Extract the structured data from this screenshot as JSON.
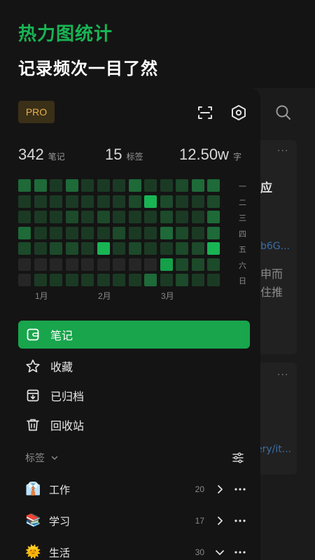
{
  "header": {
    "title": "热力图统计",
    "subtitle": "记录频次一目了然"
  },
  "background": {
    "title_fragment": "应",
    "link1": "b6G...",
    "text1": "申而",
    "text2": "住推",
    "link2": "ery/it...",
    "more": "···"
  },
  "drawer": {
    "pro_label": "PRO",
    "icons": {
      "scan": "scan-icon",
      "settings": "hexagon-settings-icon",
      "search": "search-icon"
    },
    "stats": [
      {
        "value": "342",
        "label": "笔记"
      },
      {
        "value": "15",
        "label": "标签"
      },
      {
        "value": "12.50w",
        "label": "字"
      }
    ],
    "heatmap": {
      "weekdays": [
        "一",
        "二",
        "三",
        "四",
        "五",
        "六",
        "日"
      ],
      "months": [
        "1月",
        "2月",
        "3月"
      ],
      "levels": [
        [
          3,
          3,
          1,
          3,
          1,
          1,
          1,
          3,
          1,
          1,
          2,
          3,
          3
        ],
        [
          1,
          1,
          1,
          1,
          1,
          1,
          1,
          2,
          5,
          2,
          1,
          1,
          2
        ],
        [
          1,
          1,
          1,
          2,
          1,
          2,
          1,
          1,
          1,
          2,
          1,
          1,
          3
        ],
        [
          3,
          1,
          1,
          1,
          1,
          1,
          2,
          1,
          1,
          3,
          2,
          1,
          3
        ],
        [
          2,
          1,
          2,
          2,
          1,
          5,
          1,
          2,
          1,
          1,
          2,
          2,
          5
        ],
        [
          0,
          0,
          0,
          0,
          0,
          0,
          0,
          0,
          0,
          4,
          2,
          2,
          2
        ],
        [
          0,
          1,
          1,
          1,
          1,
          1,
          1,
          1,
          3,
          1,
          2,
          1,
          1
        ]
      ],
      "colors": [
        "#262626",
        "#1b3a24",
        "#1c4a2a",
        "#1e6a38",
        "#15a04a",
        "#19b454"
      ]
    },
    "nav": [
      {
        "label": "笔记",
        "icon": "note-icon",
        "active": true
      },
      {
        "label": "收藏",
        "icon": "star-icon",
        "active": false
      },
      {
        "label": "已归档",
        "icon": "archive-icon",
        "active": false
      },
      {
        "label": "回收站",
        "icon": "trash-icon",
        "active": false
      }
    ],
    "tags_header": "标签",
    "tags": [
      {
        "emoji": "👔",
        "name": "工作",
        "count": "20",
        "expanded": false
      },
      {
        "emoji": "📚",
        "name": "学习",
        "count": "17",
        "expanded": false
      },
      {
        "emoji": "🌞",
        "name": "生活",
        "count": "30",
        "expanded": true
      }
    ],
    "accent_color": "#18a54c",
    "pro_color": "#e9b04d"
  }
}
